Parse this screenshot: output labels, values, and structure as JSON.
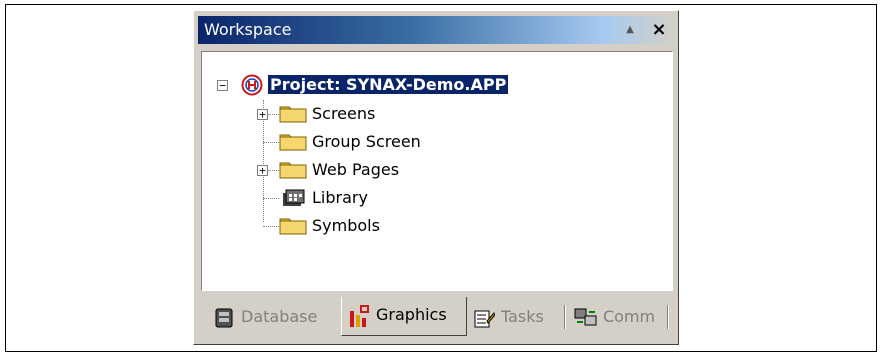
{
  "workspace": {
    "title": "Workspace",
    "close_label": "×",
    "up_label": "▲"
  },
  "tree": {
    "root": {
      "label": "Project: SYNAX-Demo.APP",
      "expander": "−"
    },
    "items": [
      {
        "label": "Screens",
        "icon": "folder-icon",
        "expander": "+"
      },
      {
        "label": "Group Screen",
        "icon": "folder-icon"
      },
      {
        "label": "Web Pages",
        "icon": "folder-icon",
        "expander": "+"
      },
      {
        "label": "Library",
        "icon": "library-icon"
      },
      {
        "label": "Symbols",
        "icon": "folder-icon"
      }
    ]
  },
  "tabs": [
    {
      "label": "Database",
      "icon": "database-icon",
      "active": false
    },
    {
      "label": "Graphics",
      "icon": "graphics-icon",
      "active": true
    },
    {
      "label": "Tasks",
      "icon": "tasks-icon",
      "active": false
    },
    {
      "label": "Comm",
      "icon": "comm-icon",
      "active": false
    }
  ],
  "colors": {
    "selection": "#0a246a",
    "folder": "#f5d76e"
  }
}
